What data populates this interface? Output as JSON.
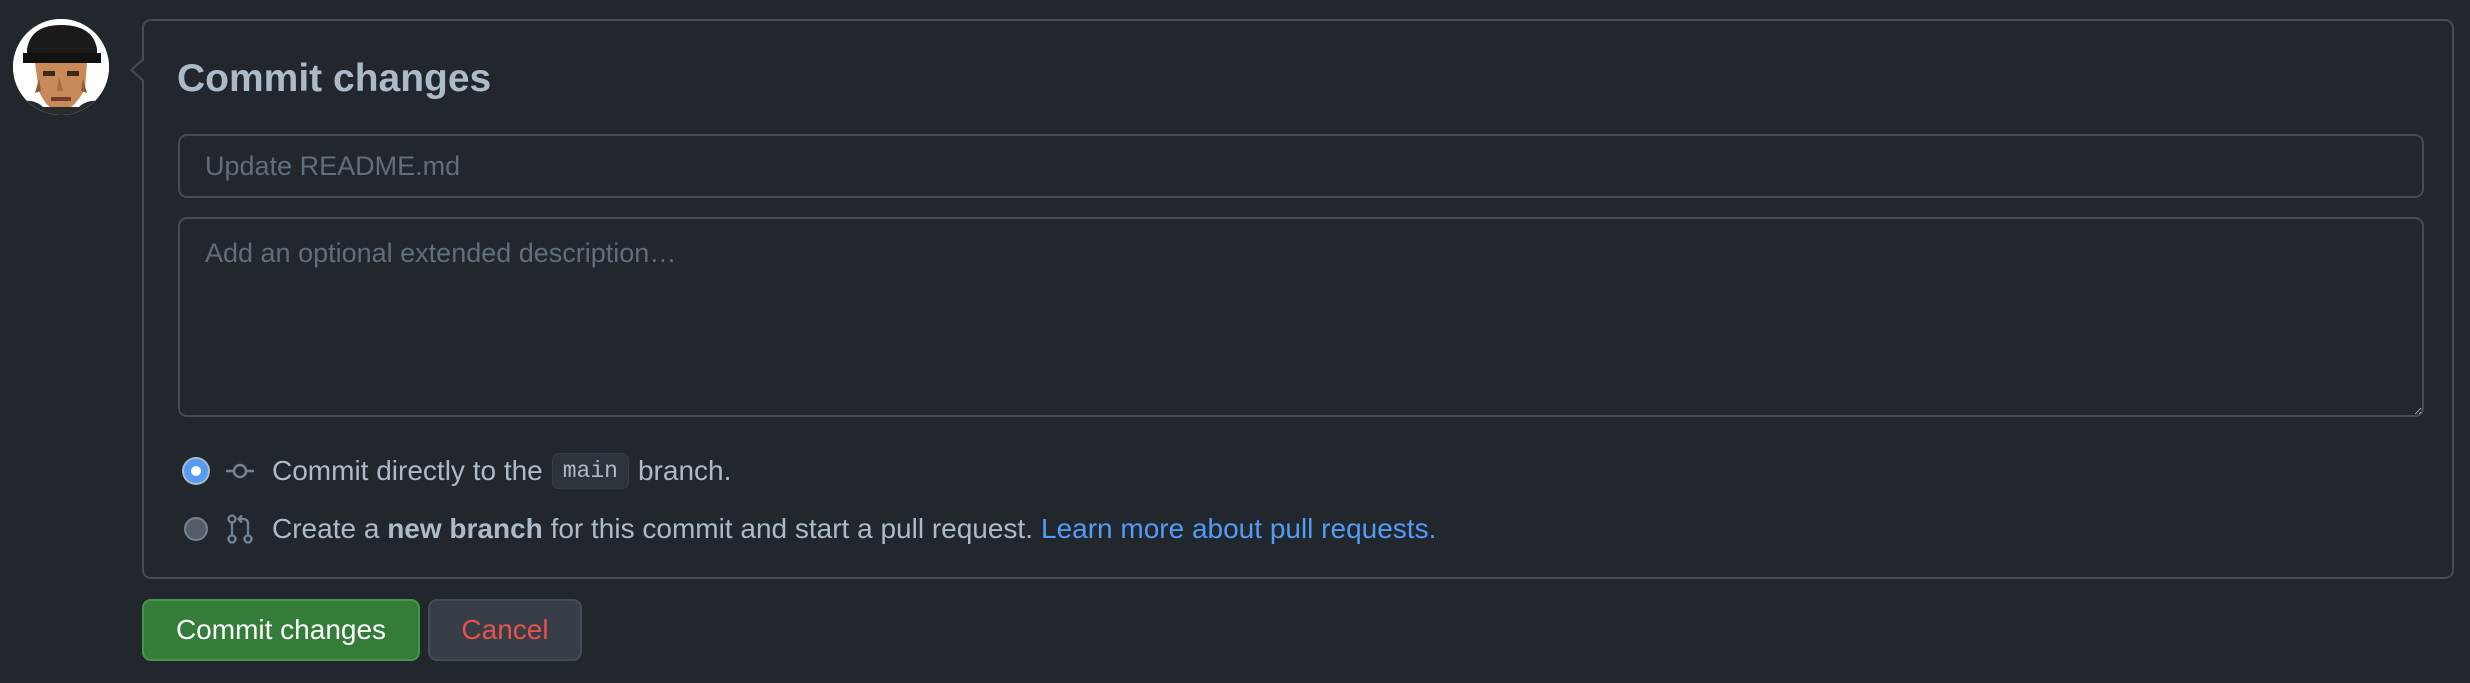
{
  "avatar": {
    "icon": "user-avatar-icon"
  },
  "commit_form": {
    "title": "Commit changes",
    "summary_placeholder": "Update README.md",
    "summary_value": "",
    "description_placeholder": "Add an optional extended description…",
    "description_value": "",
    "options": {
      "direct": {
        "checked": true,
        "icon": "git-commit-icon",
        "prefix": "Commit directly to the",
        "branch": "main",
        "suffix": "branch."
      },
      "new_branch": {
        "checked": false,
        "icon": "git-pull-request-icon",
        "prefix": "Create a",
        "bold": "new branch",
        "suffix": "for this commit and start a pull request.",
        "link": "Learn more about pull requests."
      }
    }
  },
  "buttons": {
    "commit_label": "Commit changes",
    "cancel_label": "Cancel"
  },
  "colors": {
    "background": "#22272e",
    "border": "#444c56",
    "primary_button": "#347d39",
    "link": "#539bf5",
    "danger_text": "#e5534b"
  }
}
